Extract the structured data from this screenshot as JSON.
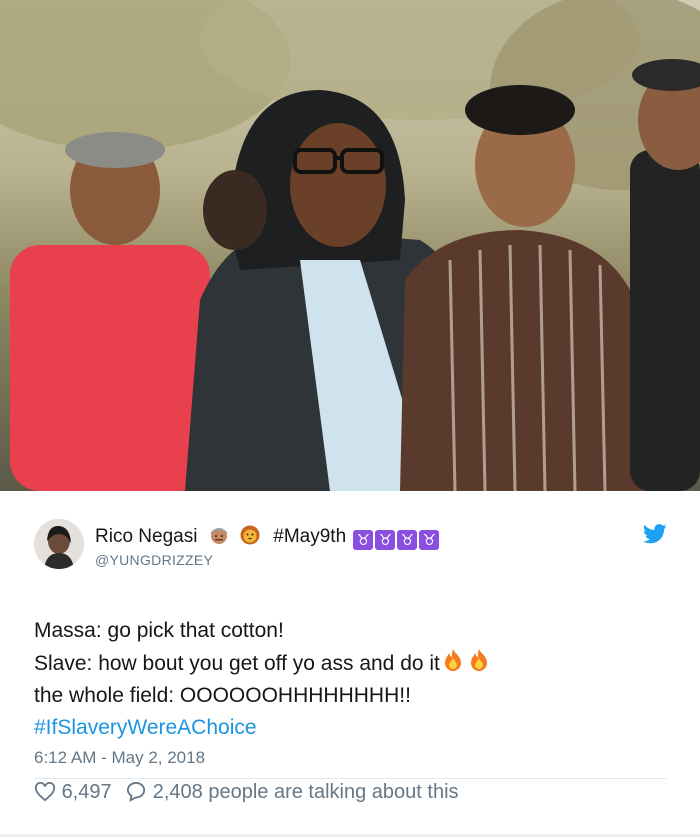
{
  "tweet": {
    "author_name": "Rico Negasi",
    "hashtag_name": "#May9th",
    "taurus_count": 4,
    "handle": "@YUNGDRIZZEY",
    "lines": [
      "Massa: go pick that cotton!",
      "Slave: how bout you get off yo ass and do it",
      "the whole field: OOOOOOHHHHHHHH!!"
    ],
    "hashtag": "#IfSlaveryWereAChoice",
    "timestamp": "6:12 AM - May 2, 2018",
    "likes": "6,497",
    "replies": "2,408 people are talking about this"
  },
  "icons": {
    "emoji_1": "person-emoji-icon",
    "emoji_2": "lion-emoji-icon",
    "taurus": "taurus-icon",
    "fire": "fire-icon",
    "brand": "twitter-bird-icon",
    "like": "heart-icon",
    "reply": "speech-bubble-icon"
  },
  "colors": {
    "link": "#1b95e0",
    "muted": "#657786",
    "brand": "#1da1f2",
    "taurus": "#8a4fe0"
  }
}
